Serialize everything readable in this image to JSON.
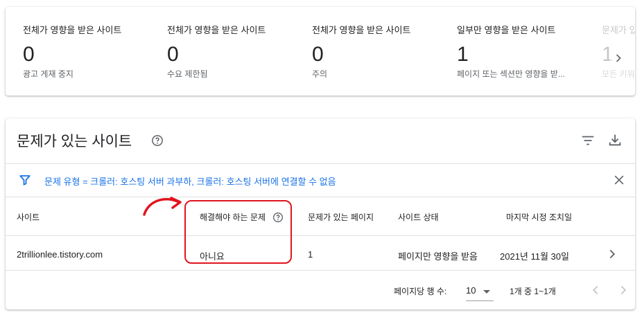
{
  "summary": {
    "stats": [
      {
        "title": "전체가 영향을 받은 사이트",
        "value": "0",
        "desc": "광고 게재 중지"
      },
      {
        "title": "전체가 영향을 받은 사이트",
        "value": "0",
        "desc": "수요 제한됨"
      },
      {
        "title": "전체가 영향을 받은 사이트",
        "value": "0",
        "desc": "주의"
      },
      {
        "title": "일부만 영향을 받은 사이트",
        "value": "1",
        "desc": "페이지 또는 섹션만 영향을 받..."
      },
      {
        "title": "문제가 있",
        "value": "1",
        "desc": "모든 키워"
      }
    ],
    "next_icon": "chevron-right-icon"
  },
  "issues": {
    "title": "문제가 있는 사이트",
    "icons": {
      "help": "help-circle-icon",
      "filter": "filter-list-icon",
      "download": "download-icon"
    },
    "filter_text": "문제 유형 = 크롤러: 호스팅 서버 과부하, 크롤러: 호스팅 서버에 연결할 수 없음",
    "columns": [
      "사이트",
      "해결해야 하는 문제",
      "문제가 있는 페이지",
      "사이트 상태",
      "마지막 시정 조치일"
    ],
    "rows": [
      {
        "site": "2trillionlee.tistory.com",
        "must_fix": "아니요",
        "pages": "1",
        "status": "페이지만 영향을 받음",
        "last_action": "2021년 11월 30일"
      }
    ],
    "pagination": {
      "rows_per_page_label": "페이지당 행 수:",
      "rows_per_page": "10",
      "range": "1개 중 1~1개"
    }
  },
  "colors": {
    "accent": "#1a73e8",
    "annotation": "#e0141e"
  }
}
